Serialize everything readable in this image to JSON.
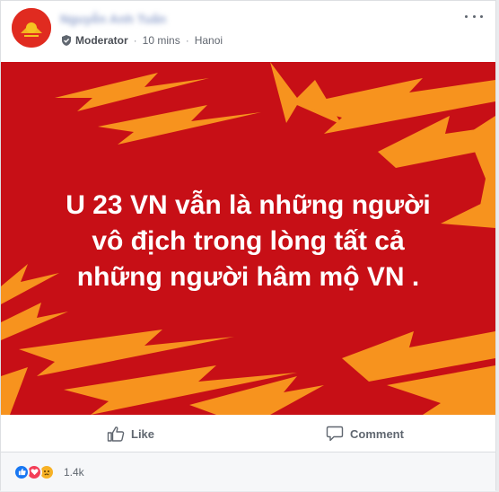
{
  "post": {
    "author_name": "Nguyễn Anh Tuấn",
    "role_label": "Moderator",
    "time": "10 mins",
    "separator": "·",
    "location": "Hanoi",
    "menu_icon": "more-horizontal-icon",
    "avatar_icon": "party-emblem-icon"
  },
  "banner": {
    "text": "U 23 VN vẫn là những người\nvô địch trong lòng tất cả\nnhững người hâm mộ VN .",
    "background": "#c70f16",
    "bolt_color": "#f7931e"
  },
  "actions": {
    "like_label": "Like",
    "comment_label": "Comment",
    "like_icon": "thumbs-up-icon",
    "comment_icon": "comment-bubble-icon"
  },
  "reactions": {
    "count": "1.4k",
    "icons": [
      "like-reaction-icon",
      "love-reaction-icon",
      "sad-reaction-icon"
    ]
  }
}
